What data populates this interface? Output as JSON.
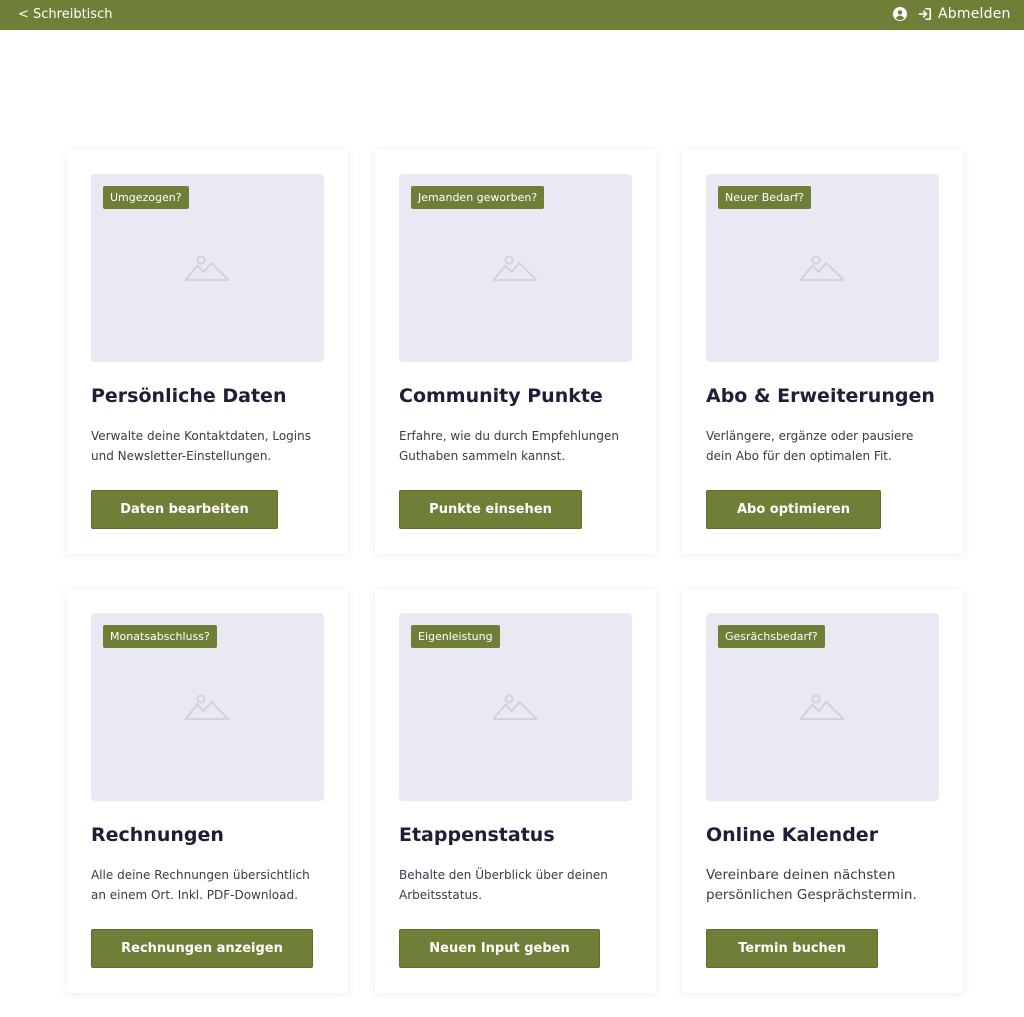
{
  "topbar": {
    "back_label": "< Schreibtisch",
    "user_icon": "user-circle-icon",
    "logout_icon": "sign-in-icon",
    "logout_label": "Abmelden",
    "bg_color": "#6f7f37"
  },
  "colors": {
    "accent": "#6f7f37",
    "thumb_bg": "#e9e9f4",
    "title": "#1e1e38"
  },
  "cards": [
    {
      "badge": "Umgezogen?",
      "title": "Persönliche Daten",
      "description": "Verwalte deine Kontaktdaten, Logins und Newsletter-Einstellungen.",
      "button": "Daten bearbeiten",
      "image_icon": "image-placeholder-icon"
    },
    {
      "badge": "Jemanden geworben?",
      "title": "Community Punkte",
      "description": "Erfahre, wie du durch Empfehlungen Guthaben sammeln kannst.",
      "button": "Punkte einsehen",
      "image_icon": "image-placeholder-icon"
    },
    {
      "badge": "Neuer Bedarf?",
      "title": "Abo & Erweiterungen",
      "description": "Verlängere, ergänze oder pausiere dein Abo für den optimalen Fit.",
      "button": "Abo optimieren",
      "image_icon": "image-placeholder-icon"
    },
    {
      "badge": "Monatsabschluss?",
      "title": "Rechnungen",
      "description": "Alle deine Rechnungen übersichtlich an einem Ort. Inkl. PDF-Download.",
      "button": "Rechnungen anzeigen",
      "image_icon": "image-placeholder-icon"
    },
    {
      "badge": "Eigenleistung",
      "title": "Etappenstatus",
      "description": "Behalte den Überblick über deinen Arbeitsstatus.",
      "button": "Neuen Input geben",
      "image_icon": "image-placeholder-icon"
    },
    {
      "badge": "Gesrächsbedarf?",
      "title": "Online Kalender",
      "description": "Vereinbare deinen nächsten persönlichen Gesprächstermin.",
      "button": "Termin buchen",
      "image_icon": "image-placeholder-icon"
    }
  ]
}
